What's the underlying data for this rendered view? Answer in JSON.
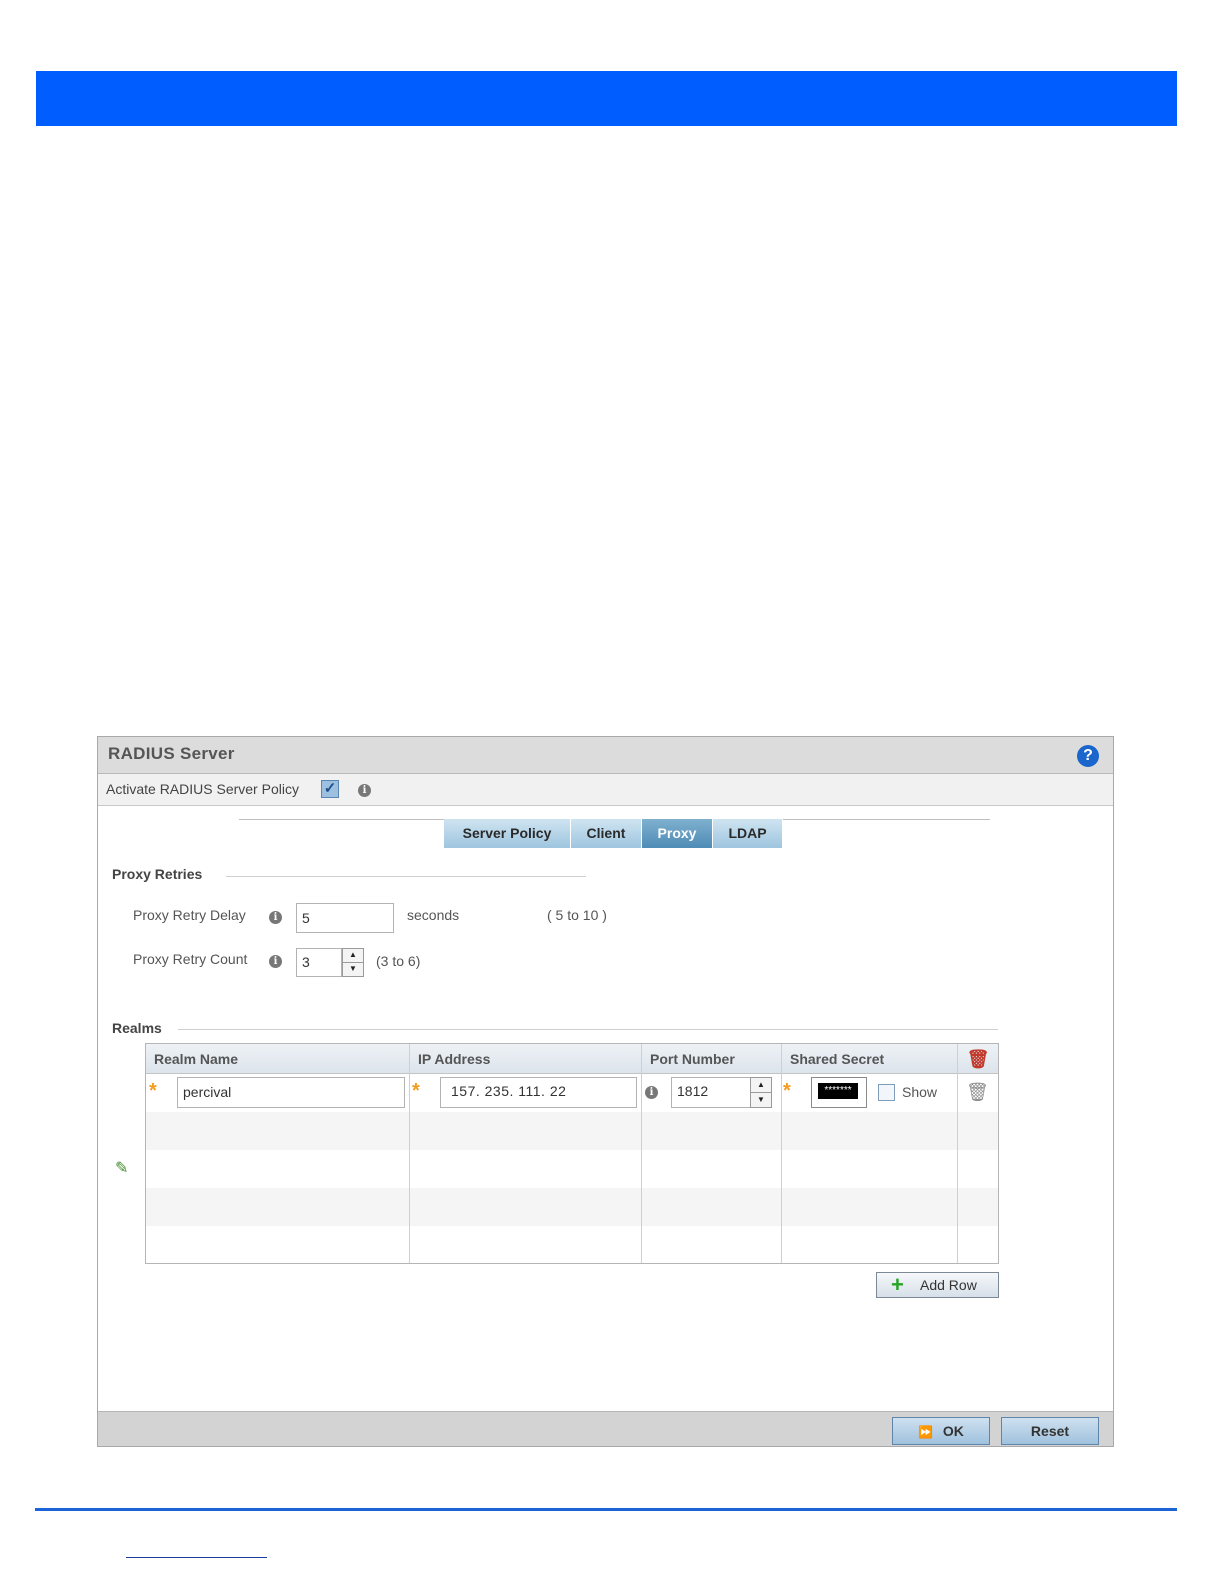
{
  "dialog": {
    "title": "RADIUS Server",
    "help_glyph": "?",
    "activate_label": "Activate RADIUS Server Policy",
    "activate_checked": true,
    "checkmark": "✓",
    "info_glyph": "i"
  },
  "tabs": [
    {
      "label": "Server Policy",
      "active": false
    },
    {
      "label": "Client",
      "active": false
    },
    {
      "label": "Proxy",
      "active": true
    },
    {
      "label": "LDAP",
      "active": false
    }
  ],
  "proxy_retries": {
    "section_label": "Proxy Retries",
    "delay_label": "Proxy Retry Delay",
    "delay_value": "5",
    "delay_unit": "seconds",
    "delay_range": "( 5 to 10 )",
    "count_label": "Proxy Retry Count",
    "count_value": "3",
    "count_range": "(3 to 6)"
  },
  "realms": {
    "section_label": "Realms",
    "columns": [
      "Realm Name",
      "IP Address",
      "Port Number",
      "Shared Secret"
    ],
    "rows": [
      {
        "realm_name": "percival",
        "ip_address": "157. 235. 111. 22",
        "port_number": "1812",
        "shared_secret": "*******",
        "show_label": "Show"
      }
    ],
    "add_row_label": "Add Row",
    "required_glyph": "*",
    "plus_glyph": "+",
    "edit_glyph": "✎",
    "trash_glyph": "🗑",
    "spin_up": "▲",
    "spin_down": "▼"
  },
  "footer": {
    "ok_label": "OK",
    "reset_label": "Reset",
    "ok_glyph": "⏩"
  },
  "colors": {
    "banner": "#005dff",
    "tab_active": "#4e8cb6",
    "tab_inactive": "#9ec5df",
    "required_star": "#f39c1f",
    "delete_icon": "#c0392b"
  }
}
